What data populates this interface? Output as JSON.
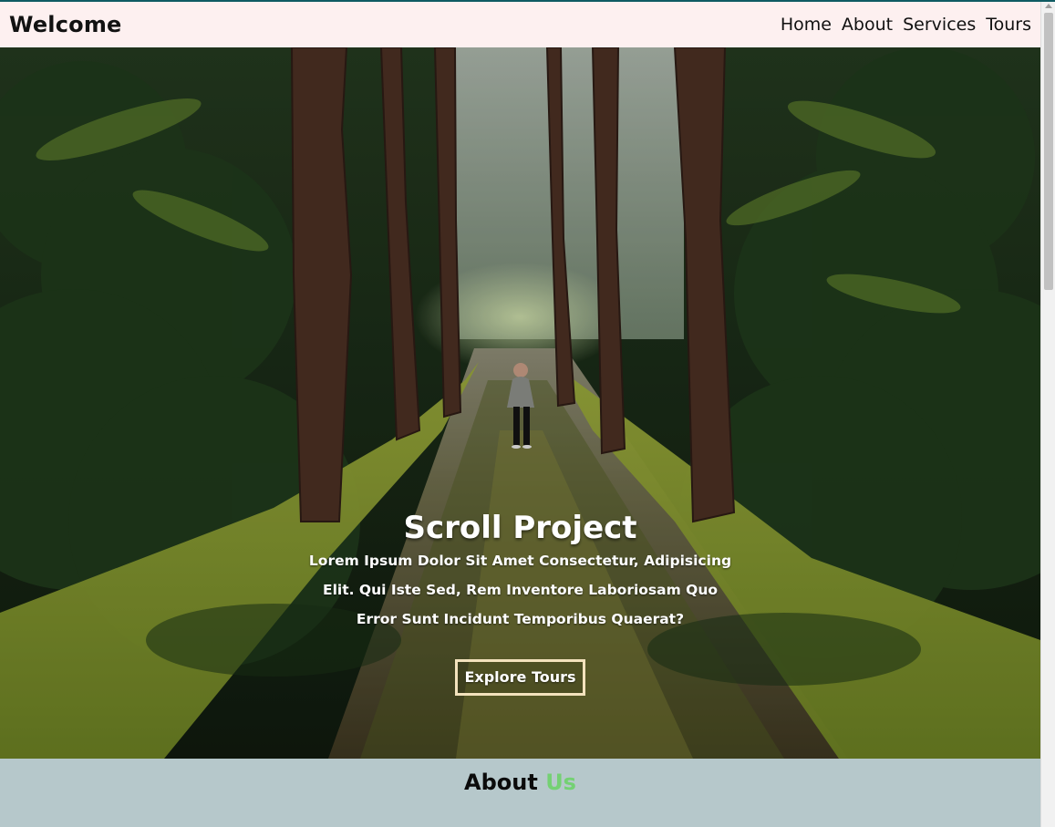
{
  "navbar": {
    "brand": "Welcome",
    "links": [
      {
        "label": "Home"
      },
      {
        "label": "About"
      },
      {
        "label": "Services"
      },
      {
        "label": "Tours"
      }
    ]
  },
  "hero": {
    "title": "Scroll Project",
    "text": "Lorem Ipsum Dolor Sit Amet Consectetur, Adipisicing Elit. Qui Iste Sed, Rem Inventore Laboriosam Quo Error Sunt Incidunt Temporibus Quaerat?",
    "button_label": "Explore Tours"
  },
  "about": {
    "title_main": "About",
    "title_accent": "Us"
  },
  "colors": {
    "top_accent": "#0f5b63",
    "navbar_bg": "#fdf0f0",
    "about_bg": "#b6c8cb",
    "accent_green": "#74d173",
    "button_border": "#f3e2bd"
  }
}
